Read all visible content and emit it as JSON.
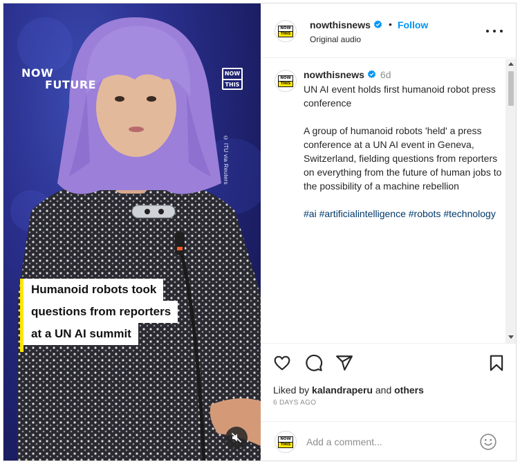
{
  "media": {
    "brand_line1": "NOW",
    "brand_line2": "FUTURE",
    "corner_logo_top": "NOW",
    "corner_logo_bottom": "THIS",
    "credit": "© ITU via Reuters",
    "caption_lines": [
      "Humanoid robots took",
      "questions from reporters",
      "at a UN AI summit"
    ],
    "mute_icon": "speaker-muted-icon",
    "accent_yellow": "#ffe600"
  },
  "header": {
    "avatar_top": "NOW",
    "avatar_bottom": "THIS",
    "username": "nowthisnews",
    "separator": "•",
    "follow_label": "Follow",
    "subtitle": "Original audio",
    "more_icon": "more-options-icon"
  },
  "post": {
    "username": "nowthisnews",
    "age": "6d",
    "title": "UN AI event holds first humanoid robot press conference",
    "body": "A group of humanoid robots 'held' a press conference at a UN AI event in Geneva, Switzerland, fielding questions from reporters on everything from the future of human jobs to the possibility of a machine rebellion",
    "hashtags": "#ai #artificialintelligence #robots #technology"
  },
  "actions": {
    "like_icon": "heart-icon",
    "comment_icon": "comment-icon",
    "share_icon": "share-icon",
    "save_icon": "bookmark-icon"
  },
  "likes": {
    "prefix": "Liked by",
    "user": "kalandraperu",
    "and": "and",
    "others": "others",
    "date": "6 DAYS AGO"
  },
  "comment_box": {
    "placeholder": "Add a comment...",
    "emoji_icon": "emoji-icon"
  },
  "colors": {
    "link_blue": "#0095f6",
    "hashtag_blue": "#00376b",
    "verified_blue": "#0095f6"
  }
}
